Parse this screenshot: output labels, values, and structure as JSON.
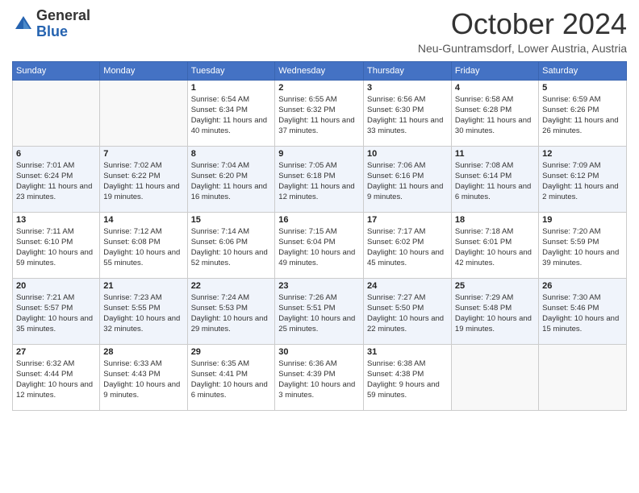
{
  "header": {
    "logo_general": "General",
    "logo_blue": "Blue",
    "month_title": "October 2024",
    "location": "Neu-Guntramsdorf, Lower Austria, Austria"
  },
  "weekdays": [
    "Sunday",
    "Monday",
    "Tuesday",
    "Wednesday",
    "Thursday",
    "Friday",
    "Saturday"
  ],
  "weeks": [
    [
      {
        "day": "",
        "info": ""
      },
      {
        "day": "",
        "info": ""
      },
      {
        "day": "1",
        "info": "Sunrise: 6:54 AM\nSunset: 6:34 PM\nDaylight: 11 hours and 40 minutes."
      },
      {
        "day": "2",
        "info": "Sunrise: 6:55 AM\nSunset: 6:32 PM\nDaylight: 11 hours and 37 minutes."
      },
      {
        "day": "3",
        "info": "Sunrise: 6:56 AM\nSunset: 6:30 PM\nDaylight: 11 hours and 33 minutes."
      },
      {
        "day": "4",
        "info": "Sunrise: 6:58 AM\nSunset: 6:28 PM\nDaylight: 11 hours and 30 minutes."
      },
      {
        "day": "5",
        "info": "Sunrise: 6:59 AM\nSunset: 6:26 PM\nDaylight: 11 hours and 26 minutes."
      }
    ],
    [
      {
        "day": "6",
        "info": "Sunrise: 7:01 AM\nSunset: 6:24 PM\nDaylight: 11 hours and 23 minutes."
      },
      {
        "day": "7",
        "info": "Sunrise: 7:02 AM\nSunset: 6:22 PM\nDaylight: 11 hours and 19 minutes."
      },
      {
        "day": "8",
        "info": "Sunrise: 7:04 AM\nSunset: 6:20 PM\nDaylight: 11 hours and 16 minutes."
      },
      {
        "day": "9",
        "info": "Sunrise: 7:05 AM\nSunset: 6:18 PM\nDaylight: 11 hours and 12 minutes."
      },
      {
        "day": "10",
        "info": "Sunrise: 7:06 AM\nSunset: 6:16 PM\nDaylight: 11 hours and 9 minutes."
      },
      {
        "day": "11",
        "info": "Sunrise: 7:08 AM\nSunset: 6:14 PM\nDaylight: 11 hours and 6 minutes."
      },
      {
        "day": "12",
        "info": "Sunrise: 7:09 AM\nSunset: 6:12 PM\nDaylight: 11 hours and 2 minutes."
      }
    ],
    [
      {
        "day": "13",
        "info": "Sunrise: 7:11 AM\nSunset: 6:10 PM\nDaylight: 10 hours and 59 minutes."
      },
      {
        "day": "14",
        "info": "Sunrise: 7:12 AM\nSunset: 6:08 PM\nDaylight: 10 hours and 55 minutes."
      },
      {
        "day": "15",
        "info": "Sunrise: 7:14 AM\nSunset: 6:06 PM\nDaylight: 10 hours and 52 minutes."
      },
      {
        "day": "16",
        "info": "Sunrise: 7:15 AM\nSunset: 6:04 PM\nDaylight: 10 hours and 49 minutes."
      },
      {
        "day": "17",
        "info": "Sunrise: 7:17 AM\nSunset: 6:02 PM\nDaylight: 10 hours and 45 minutes."
      },
      {
        "day": "18",
        "info": "Sunrise: 7:18 AM\nSunset: 6:01 PM\nDaylight: 10 hours and 42 minutes."
      },
      {
        "day": "19",
        "info": "Sunrise: 7:20 AM\nSunset: 5:59 PM\nDaylight: 10 hours and 39 minutes."
      }
    ],
    [
      {
        "day": "20",
        "info": "Sunrise: 7:21 AM\nSunset: 5:57 PM\nDaylight: 10 hours and 35 minutes."
      },
      {
        "day": "21",
        "info": "Sunrise: 7:23 AM\nSunset: 5:55 PM\nDaylight: 10 hours and 32 minutes."
      },
      {
        "day": "22",
        "info": "Sunrise: 7:24 AM\nSunset: 5:53 PM\nDaylight: 10 hours and 29 minutes."
      },
      {
        "day": "23",
        "info": "Sunrise: 7:26 AM\nSunset: 5:51 PM\nDaylight: 10 hours and 25 minutes."
      },
      {
        "day": "24",
        "info": "Sunrise: 7:27 AM\nSunset: 5:50 PM\nDaylight: 10 hours and 22 minutes."
      },
      {
        "day": "25",
        "info": "Sunrise: 7:29 AM\nSunset: 5:48 PM\nDaylight: 10 hours and 19 minutes."
      },
      {
        "day": "26",
        "info": "Sunrise: 7:30 AM\nSunset: 5:46 PM\nDaylight: 10 hours and 15 minutes."
      }
    ],
    [
      {
        "day": "27",
        "info": "Sunrise: 6:32 AM\nSunset: 4:44 PM\nDaylight: 10 hours and 12 minutes."
      },
      {
        "day": "28",
        "info": "Sunrise: 6:33 AM\nSunset: 4:43 PM\nDaylight: 10 hours and 9 minutes."
      },
      {
        "day": "29",
        "info": "Sunrise: 6:35 AM\nSunset: 4:41 PM\nDaylight: 10 hours and 6 minutes."
      },
      {
        "day": "30",
        "info": "Sunrise: 6:36 AM\nSunset: 4:39 PM\nDaylight: 10 hours and 3 minutes."
      },
      {
        "day": "31",
        "info": "Sunrise: 6:38 AM\nSunset: 4:38 PM\nDaylight: 9 hours and 59 minutes."
      },
      {
        "day": "",
        "info": ""
      },
      {
        "day": "",
        "info": ""
      }
    ]
  ]
}
